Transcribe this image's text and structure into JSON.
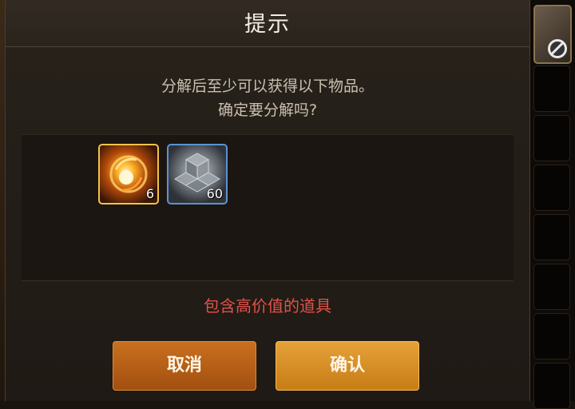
{
  "dialog": {
    "title": "提示",
    "message_line1": "分解后至少可以获得以下物品。",
    "message_line2": "确定要分解吗?",
    "warning": "包含高价值的道具",
    "cancel_label": "取消",
    "confirm_label": "确认"
  },
  "items": [
    {
      "icon": "fire-orb-icon",
      "count": "6",
      "frame_color": "#f1c34b"
    },
    {
      "icon": "crystal-cubes-icon",
      "count": "60",
      "frame_color": "#5b93d3"
    }
  ],
  "background": {
    "side_slots": [
      {
        "icon": "no-entry-icon"
      }
    ]
  },
  "colors": {
    "warning": "#e2524a",
    "cancel_button": "#b85f18",
    "confirm_button": "#d98d24",
    "title_text": "#f3efe6"
  }
}
